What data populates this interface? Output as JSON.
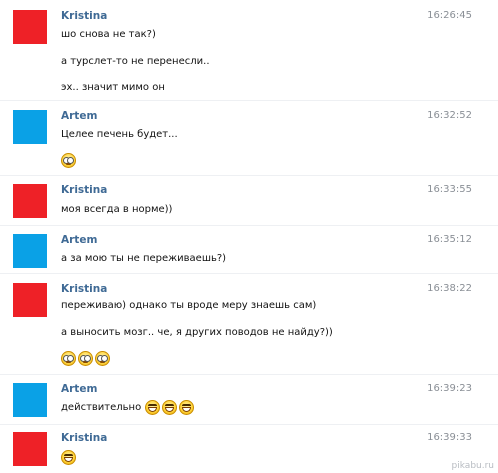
{
  "colors": {
    "kristina_avatar": "#ee2127",
    "artem_avatar": "#0aa1e6",
    "sender_name": "#3f6a95",
    "timestamp": "#8a8f96"
  },
  "messages": [
    {
      "sender": "Kristina",
      "time": "16:26:45",
      "lines": [
        "шо снова не так?)",
        "а турслет-то не перенесли..",
        "эх.. значит мимо он"
      ]
    },
    {
      "sender": "Artem",
      "time": "16:32:52",
      "lines": [
        "Целее печень будет..."
      ],
      "emoji_line": "emoji-eyes"
    },
    {
      "sender": "Kristina",
      "time": "16:33:55",
      "lines": [
        "моя всегда в норме))"
      ]
    },
    {
      "sender": "Artem",
      "time": "16:35:12",
      "lines": [
        "а за мою ты не переживаешь?)"
      ]
    },
    {
      "sender": "Kristina",
      "time": "16:38:22",
      "lines": [
        "переживаю) однако ты вроде меру знаешь сам)",
        "а выносить мозг.. че, я других поводов не найду?))"
      ],
      "emoji_line": "emoji-eyes x3"
    },
    {
      "sender": "Artem",
      "time": "16:39:23",
      "lines": [
        "действительно"
      ],
      "inline_emoji": "emoji-grin x3"
    },
    {
      "sender": "Kristina",
      "time": "16:39:33",
      "lines": [],
      "emoji_line": "emoji-grin"
    }
  ],
  "watermark": "pikabu.ru"
}
